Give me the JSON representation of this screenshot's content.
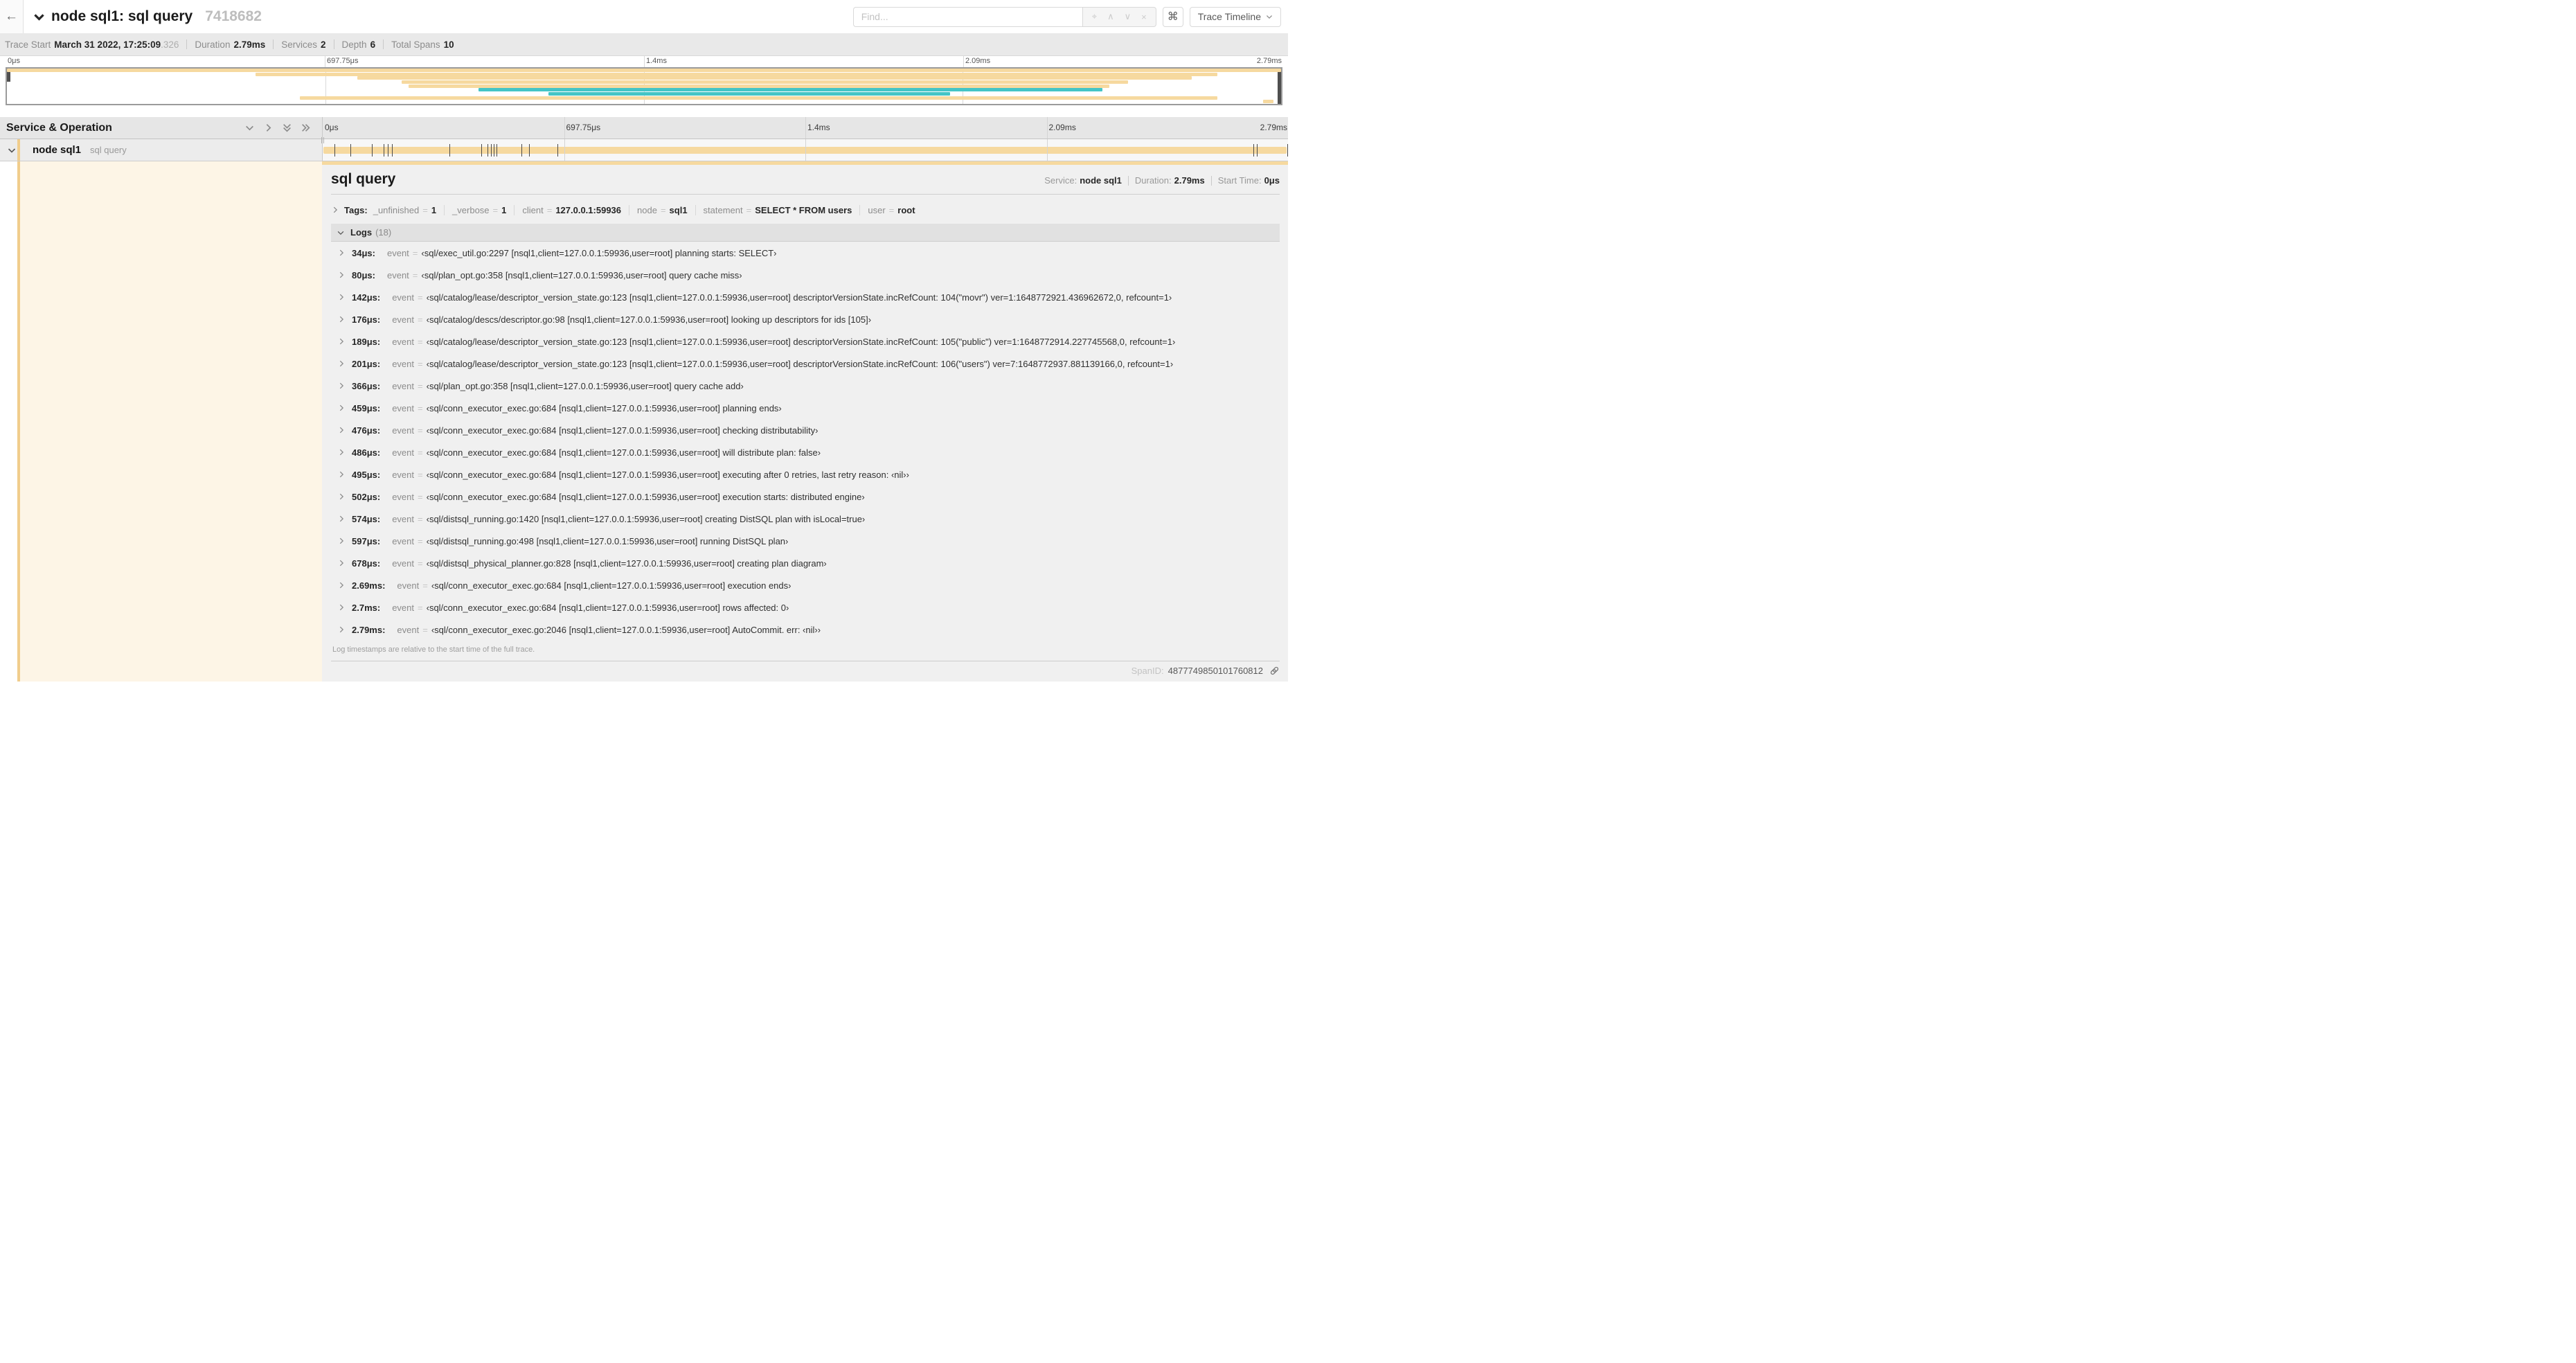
{
  "header": {
    "back_glyph": "←",
    "title": "node sql1: sql query",
    "trace_id_short": "7418682",
    "find": {
      "placeholder": "Find...",
      "locate_glyph": "⌖",
      "prev_glyph": "∧",
      "next_glyph": "∨",
      "clear_glyph": "×"
    },
    "shortcuts_glyph": "⌘",
    "view_selector_label": "Trace Timeline"
  },
  "summary": {
    "trace_start_label": "Trace Start",
    "trace_start": "March 31 2022, 17:25:09",
    "trace_start_frac": ".326",
    "duration_label": "Duration",
    "duration": "2.79ms",
    "services_label": "Services",
    "services": "2",
    "depth_label": "Depth",
    "depth": "6",
    "total_spans_label": "Total Spans",
    "total_spans": "10"
  },
  "timeline": {
    "ruler": [
      "0μs",
      "697.75μs",
      "1.4ms",
      "2.09ms",
      "2.79ms"
    ],
    "duration_us": 2790
  },
  "minimap": {
    "colors": {
      "tan": "#f6d99f",
      "teal": "#44c5c6"
    },
    "spans": [
      {
        "start": 0,
        "end": 100,
        "color": "tan"
      },
      {
        "start": 19.5,
        "end": 95,
        "color": "tan"
      },
      {
        "start": 27.5,
        "end": 93,
        "color": "tan"
      },
      {
        "start": 31,
        "end": 88,
        "color": "tan"
      },
      {
        "start": 31.5,
        "end": 86.5,
        "color": "tan"
      },
      {
        "start": 37,
        "end": 86,
        "color": "teal"
      },
      {
        "start": 42.5,
        "end": 74,
        "color": "teal"
      },
      {
        "start": 23,
        "end": 95,
        "color": "tan"
      },
      {
        "start": 98.6,
        "end": 99.4,
        "color": "tan"
      }
    ]
  },
  "grid": {
    "left_header": "Service & Operation"
  },
  "span": {
    "service": "node sql1",
    "operation": "sql query",
    "accent_color": "#f1cd8c",
    "bar_color": "#f6d99f"
  },
  "detail": {
    "title": "sql query",
    "service_label": "Service:",
    "service": "node sql1",
    "duration_label": "Duration:",
    "duration": "2.79ms",
    "start_label": "Start Time:",
    "start": "0μs",
    "tags_label": "Tags:",
    "tags": [
      {
        "key": "_unfinished",
        "value": "1"
      },
      {
        "key": "_verbose",
        "value": "1"
      },
      {
        "key": "client",
        "value": "127.0.0.1:59936"
      },
      {
        "key": "node",
        "value": "sql1"
      },
      {
        "key": "statement",
        "value": "SELECT * FROM users"
      },
      {
        "key": "user",
        "value": "root"
      }
    ],
    "logs_label": "Logs",
    "logs_count": "(18)",
    "log_event_key": "event",
    "logs": [
      {
        "t": "34μs:",
        "us": 34,
        "msg": "‹sql/exec_util.go:2297 [nsql1,client=127.0.0.1:59936,user=root] planning starts: SELECT›"
      },
      {
        "t": "80μs:",
        "us": 80,
        "msg": "‹sql/plan_opt.go:358 [nsql1,client=127.0.0.1:59936,user=root] query cache miss›"
      },
      {
        "t": "142μs:",
        "us": 142,
        "msg": "‹sql/catalog/lease/descriptor_version_state.go:123 [nsql1,client=127.0.0.1:59936,user=root] descriptorVersionState.incRefCount: 104(\"movr\") ver=1:1648772921.436962672,0, refcount=1›"
      },
      {
        "t": "176μs:",
        "us": 176,
        "msg": "‹sql/catalog/descs/descriptor.go:98 [nsql1,client=127.0.0.1:59936,user=root] looking up descriptors for ids [105]›"
      },
      {
        "t": "189μs:",
        "us": 189,
        "msg": "‹sql/catalog/lease/descriptor_version_state.go:123 [nsql1,client=127.0.0.1:59936,user=root] descriptorVersionState.incRefCount: 105(\"public\") ver=1:1648772914.227745568,0, refcount=1›"
      },
      {
        "t": "201μs:",
        "us": 201,
        "msg": "‹sql/catalog/lease/descriptor_version_state.go:123 [nsql1,client=127.0.0.1:59936,user=root] descriptorVersionState.incRefCount: 106(\"users\") ver=7:1648772937.881139166,0, refcount=1›"
      },
      {
        "t": "366μs:",
        "us": 366,
        "msg": "‹sql/plan_opt.go:358 [nsql1,client=127.0.0.1:59936,user=root] query cache add›"
      },
      {
        "t": "459μs:",
        "us": 459,
        "msg": "‹sql/conn_executor_exec.go:684 [nsql1,client=127.0.0.1:59936,user=root] planning ends›"
      },
      {
        "t": "476μs:",
        "us": 476,
        "msg": "‹sql/conn_executor_exec.go:684 [nsql1,client=127.0.0.1:59936,user=root] checking distributability›"
      },
      {
        "t": "486μs:",
        "us": 486,
        "msg": "‹sql/conn_executor_exec.go:684 [nsql1,client=127.0.0.1:59936,user=root] will distribute plan: false›"
      },
      {
        "t": "495μs:",
        "us": 495,
        "msg": "‹sql/conn_executor_exec.go:684 [nsql1,client=127.0.0.1:59936,user=root] executing after 0 retries, last retry reason: ‹nil››"
      },
      {
        "t": "502μs:",
        "us": 502,
        "msg": "‹sql/conn_executor_exec.go:684 [nsql1,client=127.0.0.1:59936,user=root] execution starts: distributed engine›"
      },
      {
        "t": "574μs:",
        "us": 574,
        "msg": "‹sql/distsql_running.go:1420 [nsql1,client=127.0.0.1:59936,user=root] creating DistSQL plan with isLocal=true›"
      },
      {
        "t": "597μs:",
        "us": 597,
        "msg": "‹sql/distsql_running.go:498 [nsql1,client=127.0.0.1:59936,user=root] running DistSQL plan›"
      },
      {
        "t": "678μs:",
        "us": 678,
        "msg": "‹sql/distsql_physical_planner.go:828 [nsql1,client=127.0.0.1:59936,user=root] creating plan diagram›"
      },
      {
        "t": "2.69ms:",
        "us": 2690,
        "msg": "‹sql/conn_executor_exec.go:684 [nsql1,client=127.0.0.1:59936,user=root] execution ends›"
      },
      {
        "t": "2.7ms:",
        "us": 2700,
        "msg": "‹sql/conn_executor_exec.go:684 [nsql1,client=127.0.0.1:59936,user=root] rows affected: 0›"
      },
      {
        "t": "2.79ms:",
        "us": 2790,
        "msg": "‹sql/conn_executor_exec.go:2046 [nsql1,client=127.0.0.1:59936,user=root] AutoCommit. err: ‹nil››"
      }
    ],
    "logs_note": "Log timestamps are relative to the start time of the full trace.",
    "spanid_label": "SpanID:",
    "spanid": "4877749850101760812"
  }
}
